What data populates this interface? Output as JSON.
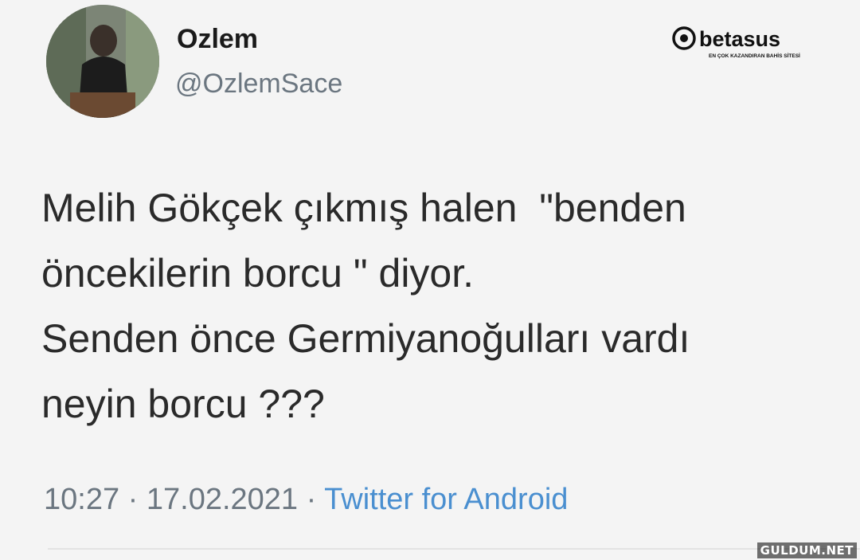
{
  "tweet": {
    "author_name": "Ozlem",
    "author_handle": "@OzlemSace",
    "text_lines": [
      "Melih Gökçek çıkmış halen  \"benden",
      "öncekilerin borcu \" diyor.",
      "Senden önce Germiyanoğulları vardı",
      "neyin borcu ???"
    ],
    "time": "10:27",
    "date": "17.02.2021",
    "source": "Twitter for Android",
    "separator": " · "
  },
  "watermarks": {
    "logo_text": "betasus",
    "logo_tagline": "EN ÇOK KAZANDIRAN BAHİS SİTESİ",
    "site": "GULDUM.NET"
  },
  "colors": {
    "background": "#f4f4f4",
    "text": "#2a2a2a",
    "muted": "#6b7680",
    "link": "#4a8fd0"
  },
  "icons": {
    "avatar": "profile-photo",
    "logo": "betasus-logo-icon"
  }
}
